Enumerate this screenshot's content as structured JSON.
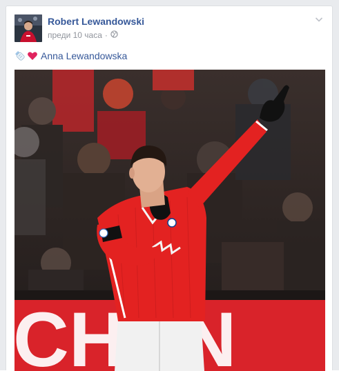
{
  "post": {
    "author": "Robert Lewandowski",
    "timestamp": "преди 10 часа",
    "separator": "·",
    "privacy_icon": "globe-icon",
    "options_icon": "chevron-down-icon",
    "text": {
      "emojis": [
        "baby-bottle-icon",
        "red-heart-icon"
      ],
      "tagged": "Anna Lewandowska"
    },
    "photo": {
      "banner_text": "CHAN",
      "subject": "player-pointing-up"
    }
  },
  "colors": {
    "link": "#365899",
    "meta": "#90949c",
    "jersey_red": "#e32221",
    "banner_red": "#d9232a"
  }
}
